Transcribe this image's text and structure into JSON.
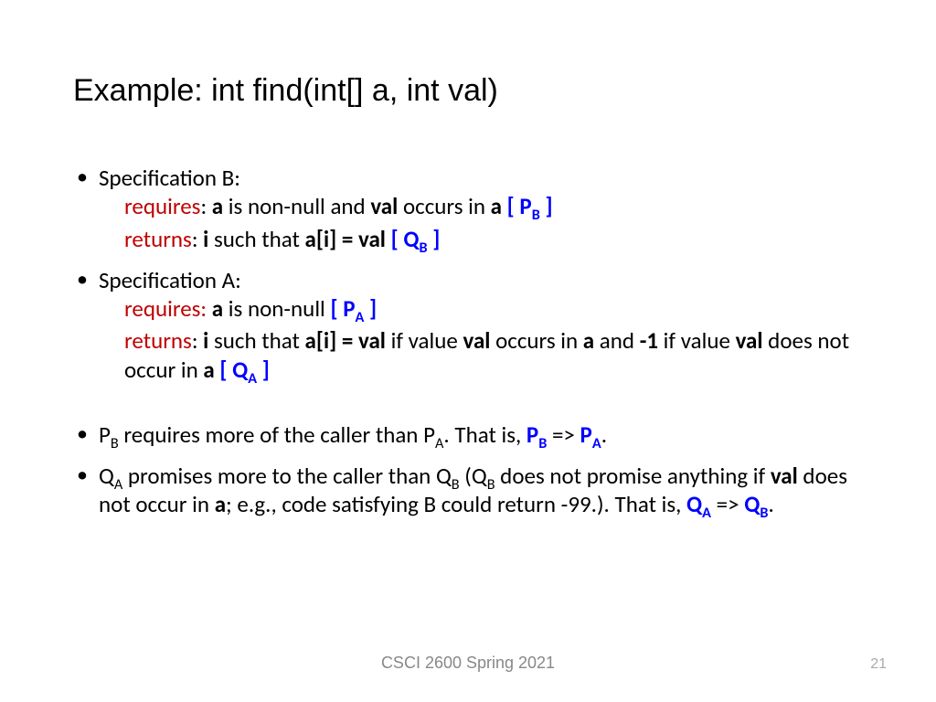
{
  "title": "Example: int find(int[] a, int val)",
  "specB": {
    "heading": "Specification B:",
    "req_label": "requires",
    "req_t1": ": ",
    "req_b1": "a",
    "req_t2": " is non-null and ",
    "req_b2": "val",
    "req_t3": " occurs in ",
    "req_b3": "a",
    "req_tag_open": "  [ P",
    "req_tag_sub": "B",
    "req_tag_close": " ]",
    "ret_label": "returns",
    "ret_t1": ": ",
    "ret_b1": "i",
    "ret_t2": " such that ",
    "ret_b2": "a[i] = val",
    "ret_tag_open": " [ Q",
    "ret_tag_sub": "B",
    "ret_tag_close": " ]"
  },
  "specA": {
    "heading": "Specification A:",
    "req_label": "requires:",
    "req_t1": " ",
    "req_b1": "a",
    "req_t2": " is non-null ",
    "req_tag_open": "[ P",
    "req_tag_sub": "A",
    "req_tag_close": " ]",
    "ret_label": "returns",
    "ret_t1": ": ",
    "ret_b1": "i",
    "ret_t2": " such that ",
    "ret_b2": "a[i] = val",
    "ret_t3": " if value ",
    "ret_b3": "val",
    "ret_t4": " occurs in ",
    "ret_b4": "a",
    "ret_t5": " and ",
    "ret_b5": "-1",
    "ret_t6": " if value ",
    "ret_b6": "val",
    "ret_t7": " does not occur in ",
    "ret_b7": "a",
    "ret_tag_open": " [ Q",
    "ret_tag_sub": "A",
    "ret_tag_close": " ]"
  },
  "p3": {
    "t1": "P",
    "s1": "B",
    "t2": " requires more of the caller than P",
    "s2": "A",
    "t3": ". That is, ",
    "b1": "P",
    "bs1": "B",
    "t4": " => ",
    "b2": "P",
    "bs2": "A",
    "t5": "."
  },
  "p4": {
    "t1": "Q",
    "s1": "A",
    "t2": " promises more to the caller than Q",
    "s2": "B",
    "t3": "  (Q",
    "s3": "B",
    "t4": " does not promise anything if ",
    "b1": "val",
    "t5": " does not occur in ",
    "b2": "a",
    "t6": "; e.g., code satisfying B could return -99.).  That is, ",
    "c1": "Q",
    "cs1": "A",
    "t7": " => ",
    "c2": "Q",
    "cs2": "B",
    "t8": "."
  },
  "footer": "CSCI 2600 Spring 2021",
  "page": "21"
}
